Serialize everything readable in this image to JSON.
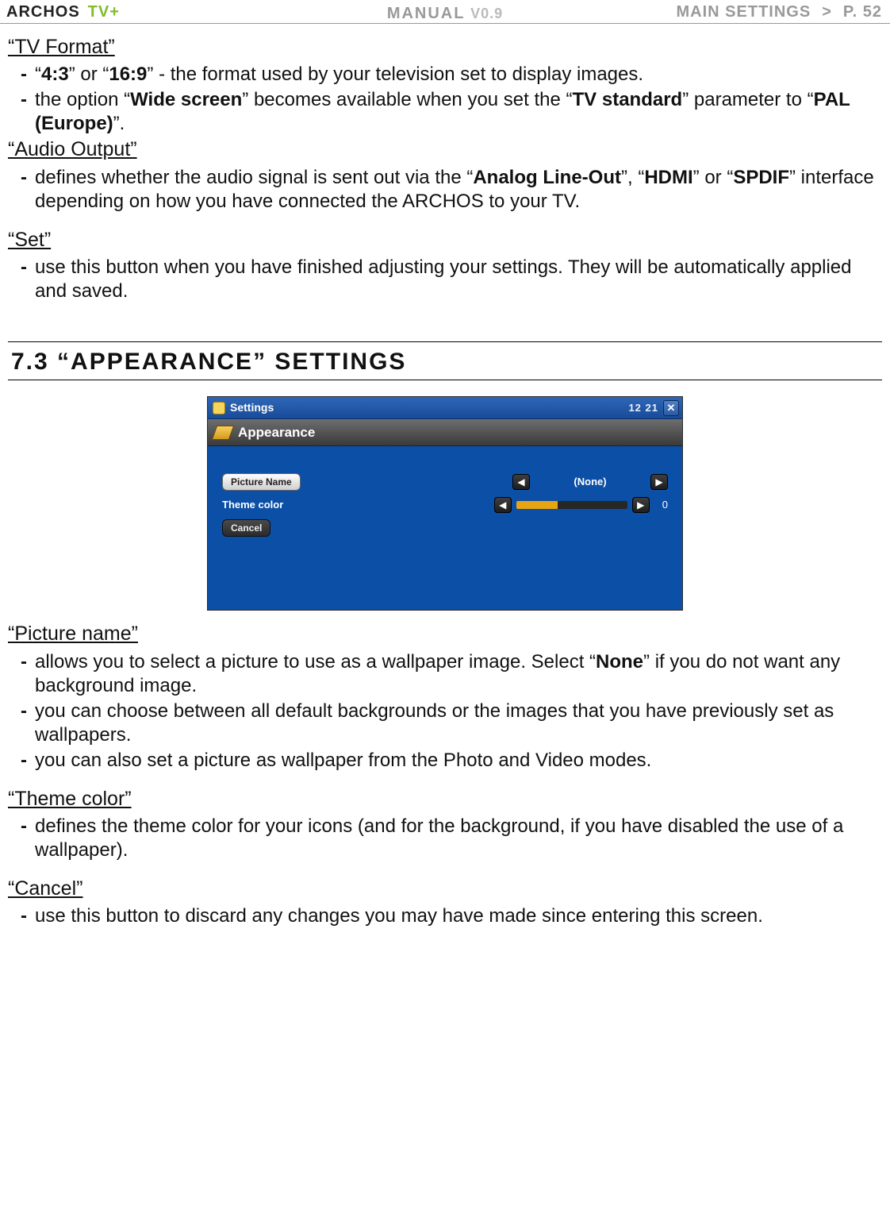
{
  "header": {
    "logo": "ARCHOS",
    "tvplus": "TV+",
    "manual": "MANUAL",
    "version": "V0.9",
    "breadcrumb": "MAIN SETTINGS",
    "chevron": ">",
    "page": "P. 52"
  },
  "tv_format": {
    "title": "“TV Format”",
    "item1_pre": "“",
    "item1_a": "4:3",
    "item1_mid": "” or “",
    "item1_b": "16:9",
    "item1_post": "” - the format used by your television set to display images.",
    "item2_pre": "the option “",
    "item2_a": "Wide screen",
    "item2_mid": "” becomes available when you set the “",
    "item2_b": "TV standard",
    "item2_mid2": "” parameter to “",
    "item2_c": "PAL (Europe)",
    "item2_post": "”."
  },
  "audio_output": {
    "title": "“Audio Output”",
    "item1_pre": "defines whether the audio signal is sent out via the “",
    "item1_a": "Analog Line-Out",
    "item1_mid": "”, “",
    "item1_b": "HDMI",
    "item1_mid2": "” or “",
    "item1_c": "SPDIF",
    "item1_post": "” interface depending on how you have connected the ARCHOS to your TV."
  },
  "set": {
    "title": "“Set”",
    "item1": "use this button when you have finished adjusting your settings. They will be automatically applied and saved."
  },
  "section": "7.3 “Appearance” settings",
  "screenshot": {
    "titlebar": "Settings",
    "time": "12 21",
    "panel": "Appearance",
    "row1_label": "Picture Name",
    "row1_value": "(None)",
    "row2_label": "Theme color",
    "row2_value": "0",
    "cancel": "Cancel"
  },
  "picture_name": {
    "title": "“Picture name”",
    "item1_pre": "allows you to select a picture to use as a wallpaper image. Select “",
    "item1_a": "None",
    "item1_post": "” if you do not want any background image.",
    "item2": "you can choose between all default backgrounds or the images that you have previously set as wallpapers.",
    "item3": "you can also set a picture as wallpaper from the Photo and Video modes."
  },
  "theme_color": {
    "title": "“Theme color”",
    "item1": "defines the theme color for your icons (and for the background, if you have disabled the use of a wallpaper)."
  },
  "cancel": {
    "title": "“Cancel”",
    "item1": "use this button to discard any changes you may have made since entering this screen."
  }
}
